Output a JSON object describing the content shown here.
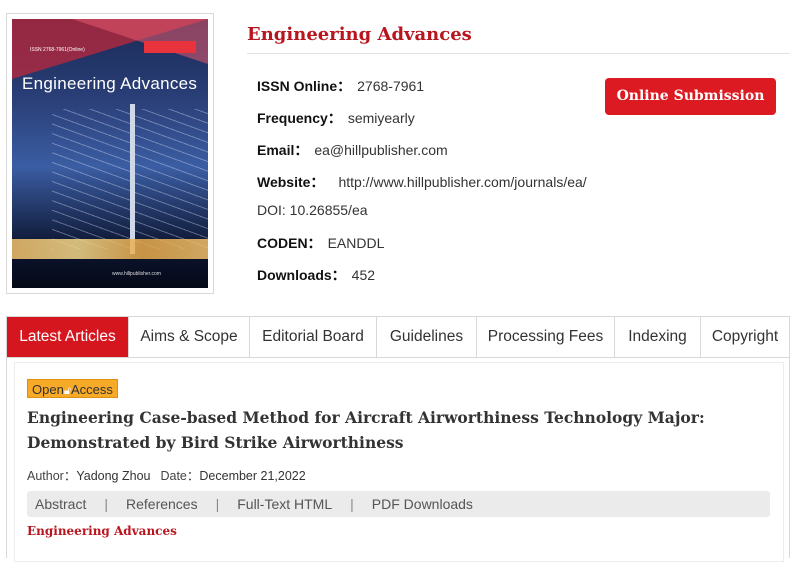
{
  "cover": {
    "issn_line": "ISSN 2768-7961(Online)",
    "title": "Engineering  Advances",
    "url": "www.hillpublisher.com"
  },
  "journal": {
    "title": "Engineering Advances",
    "issn_label": "ISSN Online：",
    "issn_value": "2768-7961",
    "frequency_label": "Frequency：",
    "frequency_value": "semiyearly",
    "email_label": "Email：",
    "email_value": "ea@hillpublisher.com",
    "website_label": "Website：",
    "website_value": "http://www.hillpublisher.com/journals/ea/",
    "doi_text": "DOI: 10.26855/ea",
    "coden_label": "CODEN：",
    "coden_value": "EANDDL",
    "downloads_label": "Downloads：",
    "downloads_value": "452",
    "submit_label": "Online Submission"
  },
  "tabs": [
    {
      "label": "Latest Articles",
      "active": true
    },
    {
      "label": "Aims & Scope"
    },
    {
      "label": "Editorial Board"
    },
    {
      "label": "Guidelines"
    },
    {
      "label": "Processing Fees"
    },
    {
      "label": "Indexing"
    },
    {
      "label": "Copyright"
    }
  ],
  "article": {
    "badge_open": "Open",
    "badge_access": "Access",
    "title": "Engineering Case-based Method for Aircraft Airworthiness Technology Major: Demonstrated by Bird Strike Airworthiness",
    "author_label": "Author：",
    "author_value": "Yadong Zhou",
    "date_label": "Date：",
    "date_value": "December 21,2022",
    "links": {
      "abstract": "Abstract",
      "references": "References",
      "fulltext": "Full-Text HTML",
      "pdf": "PDF Downloads",
      "separator": "|"
    },
    "journal_name": "Engineering Advances"
  },
  "colors": {
    "brand_red": "#d5161e",
    "title_red": "#b8161e",
    "badge_orange": "#f7a928"
  }
}
